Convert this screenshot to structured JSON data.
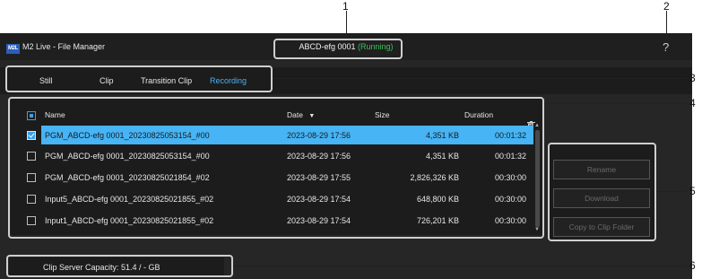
{
  "titlebar": {
    "logo": "M2L",
    "app_title": "M2 Live - File Manager",
    "device_name": "ABCD-efg 0001",
    "device_status": "(Running)",
    "help_label": "?"
  },
  "tabs": [
    {
      "label": "Still",
      "active": false
    },
    {
      "label": "Clip",
      "active": false
    },
    {
      "label": "Transition Clip",
      "active": false
    },
    {
      "label": "Recording",
      "active": true
    }
  ],
  "table": {
    "columns": {
      "name": "Name",
      "date": "Date",
      "sort_indicator": "▼",
      "size": "Size",
      "duration": "Duration"
    },
    "rows": [
      {
        "name": "PGM_ABCD-efg 0001_20230825053154_#00",
        "date": "2023-08-29 17:56",
        "size": "4,351 KB",
        "duration": "00:01:32",
        "checked": true
      },
      {
        "name": "PGM_ABCD-efg 0001_20230825053154_#00",
        "date": "2023-08-29 17:56",
        "size": "4,351 KB",
        "duration": "00:01:32",
        "checked": false
      },
      {
        "name": "PGM_ABCD-efg 0001_20230825021854_#02",
        "date": "2023-08-29 17:55",
        "size": "2,826,326 KB",
        "duration": "00:30:00",
        "checked": false
      },
      {
        "name": "Input5_ABCD-efg 0001_20230825021855_#02",
        "date": "2023-08-29 17:54",
        "size": "648,800 KB",
        "duration": "00:30:00",
        "checked": false
      },
      {
        "name": "Input1_ABCD-efg 0001_20230825021855_#02",
        "date": "2023-08-29 17:54",
        "size": "726,201 KB",
        "duration": "00:30:00",
        "checked": false
      }
    ]
  },
  "actions": {
    "rename": "Rename",
    "download": "Download",
    "copy": "Copy to Clip Folder"
  },
  "footer": {
    "capacity": "Clip Server Capacity: 51.4 / - GB"
  },
  "callouts": [
    "1",
    "2",
    "3",
    "4",
    "5",
    "6"
  ],
  "colors": {
    "accent": "#46b4f5",
    "running": "#3fbf5a",
    "background": "#262626"
  }
}
